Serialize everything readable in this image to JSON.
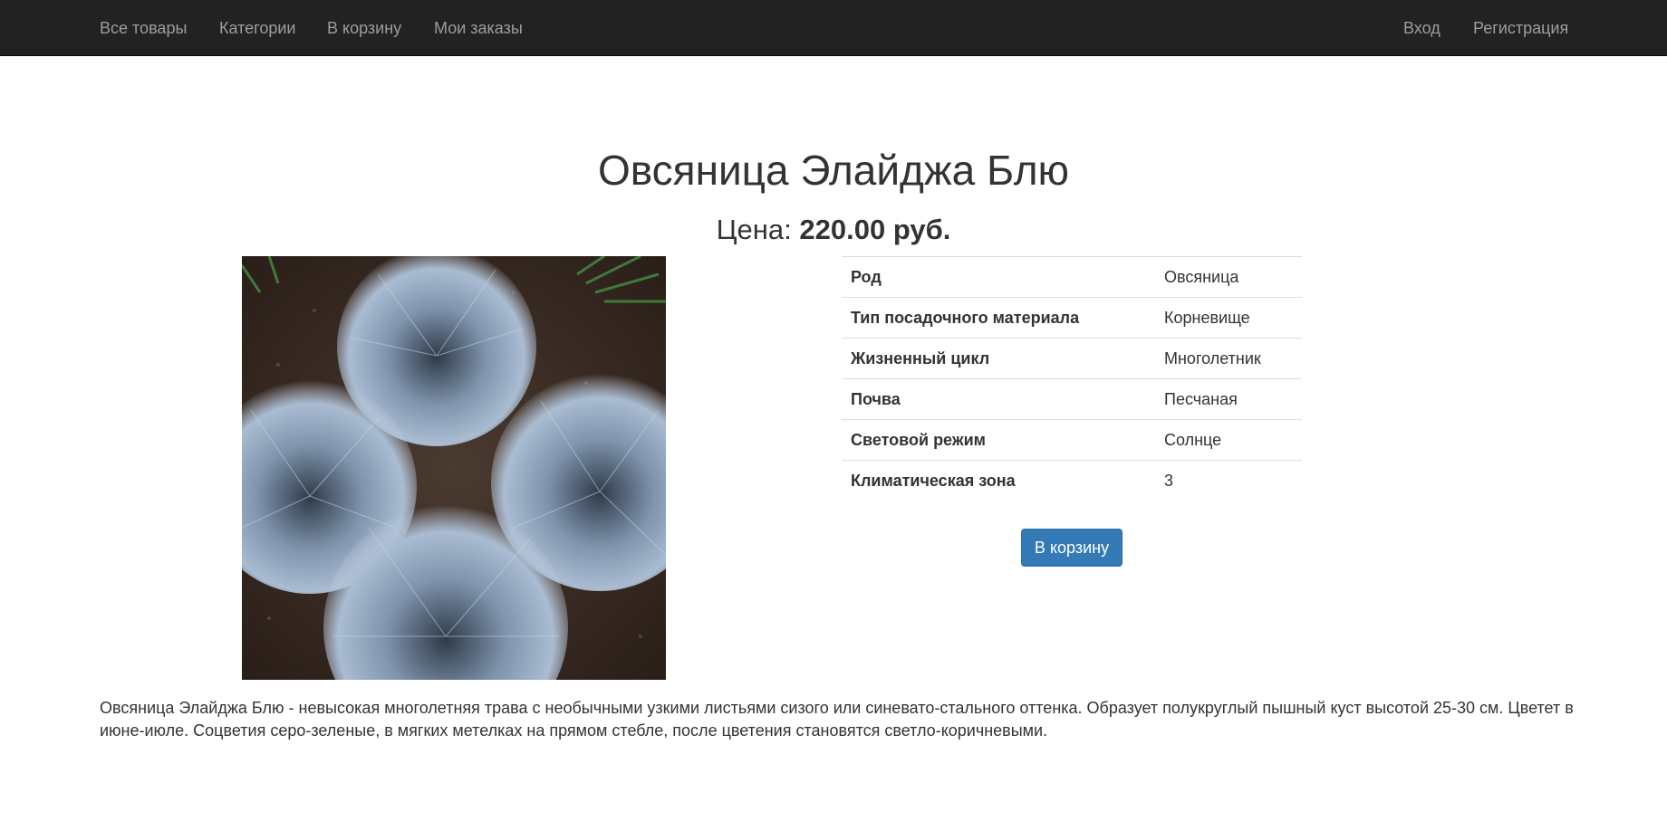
{
  "navbar": {
    "left_links": [
      "Все товары",
      "Категории",
      "В корзину",
      "Мои заказы"
    ],
    "right_links": [
      "Вход",
      "Регистрация"
    ]
  },
  "product": {
    "title": "Овсяница Элайджа Блю",
    "price_label": "Цена: ",
    "price_value": "220.00 руб.",
    "image_icon": "plant-photo",
    "specs": [
      {
        "key": "Род",
        "value": "Овсяница"
      },
      {
        "key": "Тип посадочного материала",
        "value": "Корневище"
      },
      {
        "key": "Жизненный цикл",
        "value": "Многолетник"
      },
      {
        "key": "Почва",
        "value": "Песчаная"
      },
      {
        "key": "Световой режим",
        "value": "Солнце"
      },
      {
        "key": "Климатическая зона",
        "value": "3"
      }
    ],
    "add_to_cart_label": "В корзину",
    "description": "Овсяница Элайджа Блю - невысокая многолетняя трава с необычными узкими листьями сизого или синевато-стального оттенка. Образует полукруглый пышный куст высотой 25-30 см. Цветет в июне-июле. Соцветия серо-зеленые, в мягких метелках на прямом стебле, после цветения становятся светло-коричневыми."
  },
  "colors": {
    "navbar_bg": "#222222",
    "nav_link": "#9d9d9d",
    "button_bg": "#337ab7",
    "text": "#333333"
  }
}
